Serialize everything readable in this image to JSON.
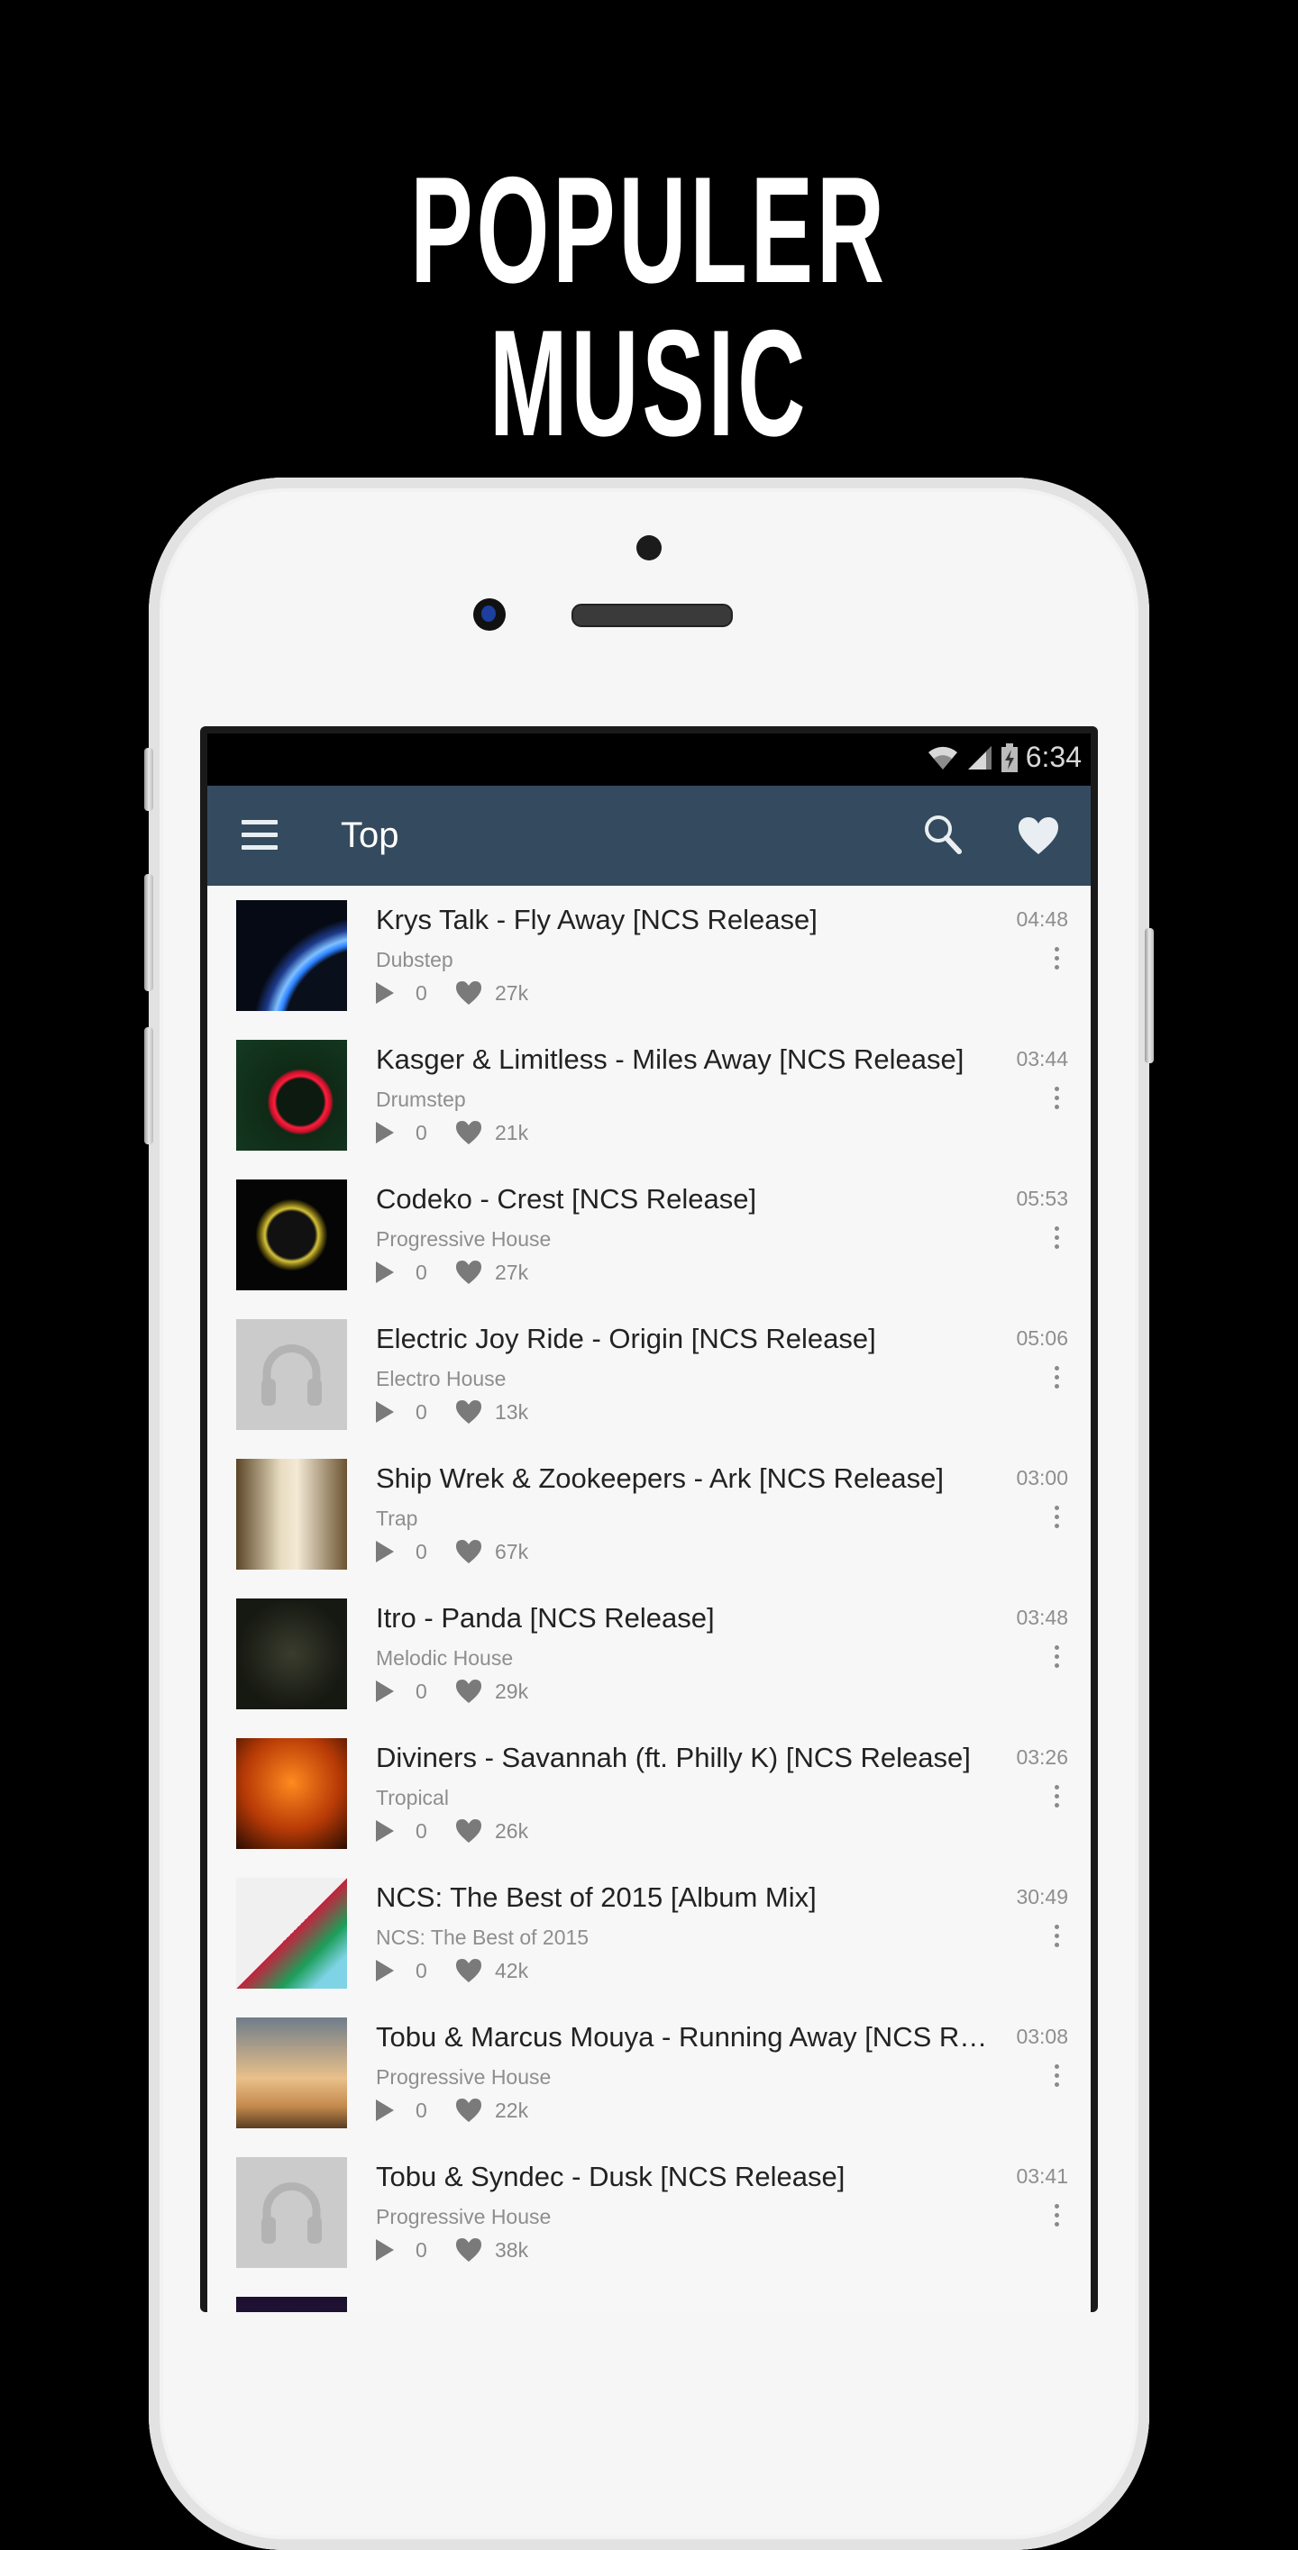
{
  "promo": {
    "title": "POPULER MUSIC"
  },
  "status_bar": {
    "time": "6:34",
    "icons": [
      "wifi-icon",
      "signal-icon",
      "battery-charging-icon"
    ]
  },
  "appbar": {
    "title": "Top",
    "icons": [
      "menu-icon",
      "search-icon",
      "heart-icon"
    ]
  },
  "colors": {
    "appbar": "#344a5e",
    "background": "#f7f7f7",
    "title_text": "#222222",
    "secondary_text": "#8e8e8e"
  },
  "tracks": [
    {
      "title": "Krys Talk - Fly Away [NCS Release]",
      "genre": "Dubstep",
      "plays": "0",
      "likes": "27k",
      "duration": "04:48",
      "art": "blue-arc"
    },
    {
      "title": "Kasger & Limitless - Miles Away [NCS Release]",
      "genre": "Drumstep",
      "plays": "0",
      "likes": "21k",
      "duration": "03:44",
      "art": "red-ring"
    },
    {
      "title": "Codeko - Crest [NCS Release]",
      "genre": "Progressive House",
      "plays": "0",
      "likes": "27k",
      "duration": "05:53",
      "art": "ncs-yellow"
    },
    {
      "title": "Electric Joy Ride - Origin [NCS Release]",
      "genre": "Electro House",
      "plays": "0",
      "likes": "13k",
      "duration": "05:06",
      "art": "placeholder"
    },
    {
      "title": "Ship Wrek & Zookeepers - Ark [NCS Release]",
      "genre": "Trap",
      "plays": "0",
      "likes": "67k",
      "duration": "03:00",
      "art": "ark"
    },
    {
      "title": "Itro - Panda [NCS Release]",
      "genre": "Melodic House",
      "plays": "0",
      "likes": "29k",
      "duration": "03:48",
      "art": "panda"
    },
    {
      "title": "Diviners - Savannah (ft. Philly K) [NCS Release]",
      "genre": "Tropical",
      "plays": "0",
      "likes": "26k",
      "duration": "03:26",
      "art": "savannah"
    },
    {
      "title": "NCS: The Best of 2015 [Album Mix]",
      "genre": "NCS: The Best of 2015",
      "plays": "0",
      "likes": "42k",
      "duration": "30:49",
      "art": "best-2015"
    },
    {
      "title": "Tobu & Marcus Mouya - Running Away [NCS Release]",
      "genre": "Progressive House",
      "plays": "0",
      "likes": "22k",
      "duration": "03:08",
      "art": "tobu"
    },
    {
      "title": "Tobu & Syndec - Dusk [NCS Release]",
      "genre": "Progressive House",
      "plays": "0",
      "likes": "38k",
      "duration": "03:41",
      "art": "placeholder"
    }
  ]
}
